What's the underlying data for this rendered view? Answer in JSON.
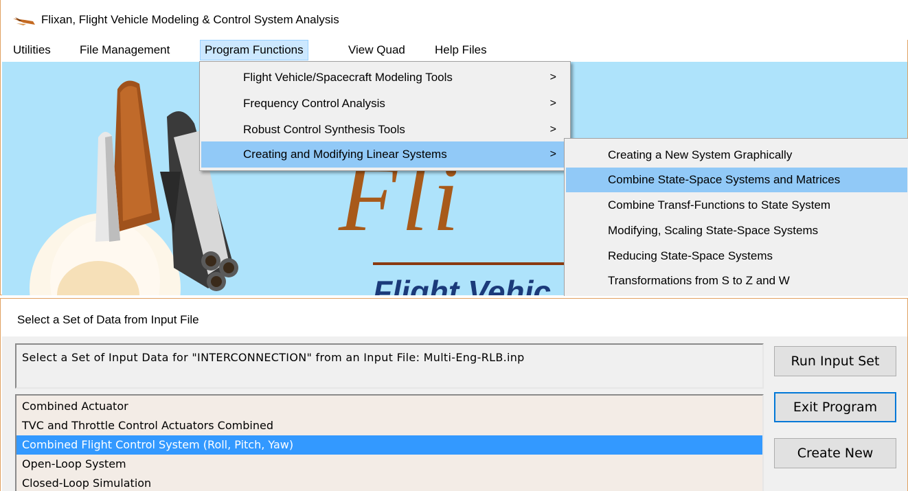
{
  "window": {
    "title": "Flixan, Flight Vehicle Modeling & Control System Analysis",
    "icon": "shuttle-icon"
  },
  "menubar": {
    "items": [
      {
        "label": "Utilities"
      },
      {
        "label": "File Management"
      },
      {
        "label": "Program Functions"
      },
      {
        "label": "View Quad"
      },
      {
        "label": "Help Files"
      }
    ],
    "active_index": 2
  },
  "splash": {
    "title_fragment": "Fli",
    "subtitle_fragment": "Flight Vehic"
  },
  "program_functions_menu": {
    "items": [
      {
        "label": "Flight Vehicle/Spacecraft Modeling Tools",
        "submenu_arrow": ">"
      },
      {
        "label": "Frequency Control Analysis",
        "submenu_arrow": ">"
      },
      {
        "label": "Robust Control Synthesis Tools",
        "submenu_arrow": ">"
      },
      {
        "label": "Creating and Modifying Linear Systems",
        "submenu_arrow": ">"
      }
    ],
    "highlighted_index": 3
  },
  "linear_systems_menu": {
    "items": [
      {
        "label": "Creating a New System Graphically"
      },
      {
        "label": "Combine State-Space Systems and Matrices"
      },
      {
        "label": "Combine Transf-Functions to State System"
      },
      {
        "label": "Modifying, Scaling State-Space Systems"
      },
      {
        "label": "Reducing State-Space Systems"
      },
      {
        "label": "Transformations from S to Z and W"
      }
    ],
    "highlighted_index": 1
  },
  "dialog": {
    "title": "Select a Set of Data from Input File",
    "prompt": "Select a Set of Input Data for \"INTERCONNECTION\" from an Input File: Multi-Eng-RLB.inp",
    "list": [
      {
        "label": "Combined Actuator"
      },
      {
        "label": "TVC and Throttle Control Actuators Combined"
      },
      {
        "label": "Combined Flight Control System (Roll, Pitch, Yaw)"
      },
      {
        "label": "Open-Loop System"
      },
      {
        "label": "Closed-Loop Simulation"
      }
    ],
    "selected_index": 2,
    "buttons": {
      "run": "Run Input Set",
      "exit": "Exit Program",
      "create": "Create New"
    }
  },
  "colors": {
    "splash_background": "#aee3fb",
    "menu_highlight": "#91c9f7",
    "list_selection": "#3399ff",
    "window_border": "#e0a060"
  }
}
